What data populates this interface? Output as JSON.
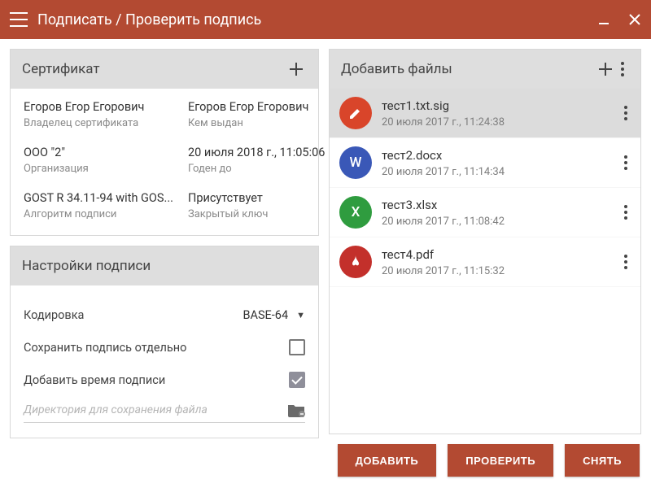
{
  "titlebar": {
    "title": "Подписать / Проверить подпись"
  },
  "certificate": {
    "header": "Сертификат",
    "fields": {
      "owner_name": "Егоров Егор Егорович",
      "owner_label": "Владелец сертификата",
      "issuer_name": "Егоров Егор Егорович",
      "issuer_label": "Кем выдан",
      "org_name": "ООО \"2\"",
      "org_label": "Организация",
      "valid_until_value": "20 июля 2018 г., 11:05:06",
      "valid_until_label": "Годен до",
      "algo_value": "GOST R 34.11-94 with GOS...",
      "algo_label": "Алгоритм подписи",
      "private_key_value": "Присутствует",
      "private_key_label": "Закрытый ключ"
    }
  },
  "settings": {
    "header": "Настройки подписи",
    "encoding_label": "Кодировка",
    "encoding_value": "BASE-64",
    "save_sig_separately_label": "Сохранить подпись отдельно",
    "save_sig_separately_checked": false,
    "add_sig_time_label": "Добавить время подписи",
    "add_sig_time_checked": true,
    "dir_placeholder": "Директория для сохранения файла"
  },
  "files": {
    "header": "Добавить файлы",
    "items": [
      {
        "name": "тест1.txt.sig",
        "date": "20 июля 2017 г., 11:24:38",
        "icon_bg": "#d9452a",
        "icon_kind": "pencil",
        "selected": true
      },
      {
        "name": "тест2.docx",
        "date": "20 июля 2017 г., 11:14:34",
        "icon_bg": "#3a58b7",
        "icon_letter": "W",
        "selected": false
      },
      {
        "name": "тест3.xlsx",
        "date": "20 июля 2017 г., 11:08:42",
        "icon_bg": "#2f9c3f",
        "icon_letter": "X",
        "selected": false
      },
      {
        "name": "тест4.pdf",
        "date": "20 июля 2017 г., 11:15:32",
        "icon_bg": "#c3302b",
        "icon_kind": "pdf",
        "selected": false
      }
    ]
  },
  "footer": {
    "add": "ДОБАВИТЬ",
    "verify": "ПРОВЕРИТЬ",
    "remove": "СНЯТЬ"
  },
  "colors": {
    "brand": "#b34a32"
  }
}
